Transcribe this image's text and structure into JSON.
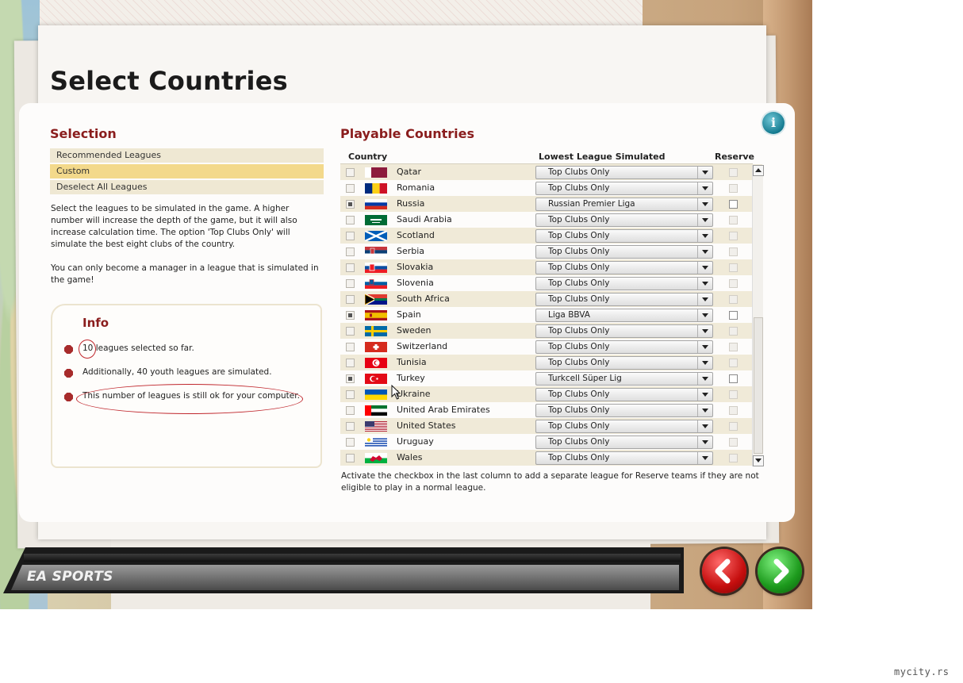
{
  "page": {
    "title": "Select Countries"
  },
  "selection": {
    "heading": "Selection",
    "options": [
      "Recommended Leagues",
      "Custom",
      "Deselect All Leagues"
    ],
    "selected_option": "Custom",
    "description1": "Select the leagues to be simulated in the game. A higher number will increase the depth of the game, but it will also increase calculation time. The option 'Top Clubs Only' will simulate the best eight clubs of the country.",
    "description2": "You can only become a manager in a league that is simulated in the game!"
  },
  "info": {
    "heading": "Info",
    "bullets": [
      "10 leagues selected so far.",
      "Additionally, 40 youth leagues are simulated.",
      "This number of leagues is still ok for your computer."
    ]
  },
  "playable": {
    "heading": "Playable Countries",
    "columns": {
      "country": "Country",
      "lowest": "Lowest League Simulated",
      "reserve": "Reserve"
    },
    "rows": [
      {
        "country": "Qatar",
        "checked": false,
        "league": "Top Clubs Only",
        "reserve_active": false,
        "flag": "qatar"
      },
      {
        "country": "Romania",
        "checked": false,
        "league": "Top Clubs Only",
        "reserve_active": false,
        "flag": "romania"
      },
      {
        "country": "Russia",
        "checked": true,
        "league": "Russian Premier Liga",
        "reserve_active": true,
        "flag": "russia"
      },
      {
        "country": "Saudi Arabia",
        "checked": false,
        "league": "Top Clubs Only",
        "reserve_active": false,
        "flag": "saudi-arabia"
      },
      {
        "country": "Scotland",
        "checked": false,
        "league": "Top Clubs Only",
        "reserve_active": false,
        "flag": "scotland"
      },
      {
        "country": "Serbia",
        "checked": false,
        "league": "Top Clubs Only",
        "reserve_active": false,
        "flag": "serbia"
      },
      {
        "country": "Slovakia",
        "checked": false,
        "league": "Top Clubs Only",
        "reserve_active": false,
        "flag": "slovakia"
      },
      {
        "country": "Slovenia",
        "checked": false,
        "league": "Top Clubs Only",
        "reserve_active": false,
        "flag": "slovenia"
      },
      {
        "country": "South Africa",
        "checked": false,
        "league": "Top Clubs Only",
        "reserve_active": false,
        "flag": "south-africa"
      },
      {
        "country": "Spain",
        "checked": true,
        "league": "Liga BBVA",
        "reserve_active": true,
        "flag": "spain"
      },
      {
        "country": "Sweden",
        "checked": false,
        "league": "Top Clubs Only",
        "reserve_active": false,
        "flag": "sweden"
      },
      {
        "country": "Switzerland",
        "checked": false,
        "league": "Top Clubs Only",
        "reserve_active": false,
        "flag": "switzerland"
      },
      {
        "country": "Tunisia",
        "checked": false,
        "league": "Top Clubs Only",
        "reserve_active": false,
        "flag": "tunisia"
      },
      {
        "country": "Turkey",
        "checked": true,
        "league": "Turkcell Süper Lig",
        "reserve_active": true,
        "flag": "turkey"
      },
      {
        "country": "Ukraine",
        "checked": false,
        "league": "Top Clubs Only",
        "reserve_active": false,
        "flag": "ukraine"
      },
      {
        "country": "United Arab Emirates",
        "checked": false,
        "league": "Top Clubs Only",
        "reserve_active": false,
        "flag": "uae"
      },
      {
        "country": "United States",
        "checked": false,
        "league": "Top Clubs Only",
        "reserve_active": false,
        "flag": "usa"
      },
      {
        "country": "Uruguay",
        "checked": false,
        "league": "Top Clubs Only",
        "reserve_active": false,
        "flag": "uruguay"
      },
      {
        "country": "Wales",
        "checked": false,
        "league": "Top Clubs Only",
        "reserve_active": false,
        "flag": "wales"
      }
    ],
    "note": "Activate the checkbox in the last column to add a separate league for Reserve teams if they are not eligible to play in a normal league."
  },
  "footer": {
    "brand": "EA SPORTS"
  },
  "icons": {
    "info": "info-icon",
    "back": "back-arrow-icon",
    "next": "next-arrow-icon"
  },
  "watermark": "mycity.rs",
  "colors": {
    "heading_red": "#8a1d1d",
    "selected_option": "#f3d98b",
    "back_button": "#c50e0e",
    "next_button": "#1d9a1d"
  }
}
